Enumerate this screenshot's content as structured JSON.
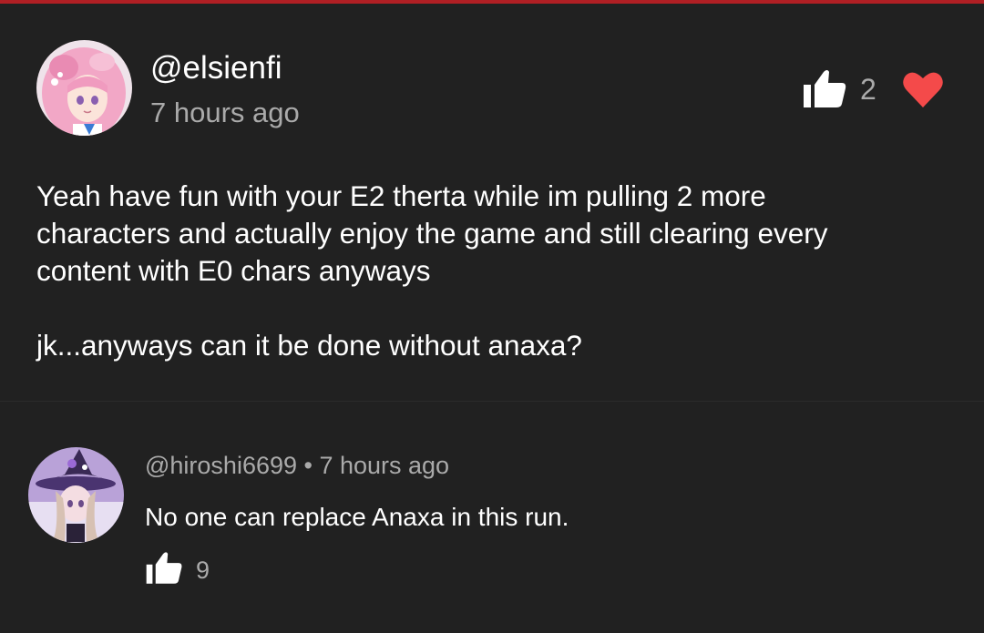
{
  "colors": {
    "background": "#212121",
    "accent_bar": "#b01f24",
    "heart": "#f44a4a",
    "secondary_text": "#aaaaaa"
  },
  "comment": {
    "avatar_icon": "avatar-pink-hair-character",
    "username": "@elsienfi",
    "timestamp": "7 hours ago",
    "like_icon": "thumbs-up-icon",
    "like_count": "2",
    "heart_icon": "heart-icon",
    "body_lines": [
      "Yeah have fun with your E2 therta while im pulling 2 more",
      "characters and actually enjoy the game and still clearing every",
      "content with E0 chars anyways"
    ],
    "body_line_last": "jk...anyways can it be done without anaxa?"
  },
  "reply": {
    "avatar_icon": "avatar-witch-hat-character",
    "meta": "@hiroshi6699 • 7 hours ago",
    "text": "No one can replace Anaxa in this run.",
    "like_icon": "thumbs-up-icon",
    "like_count": "9"
  }
}
